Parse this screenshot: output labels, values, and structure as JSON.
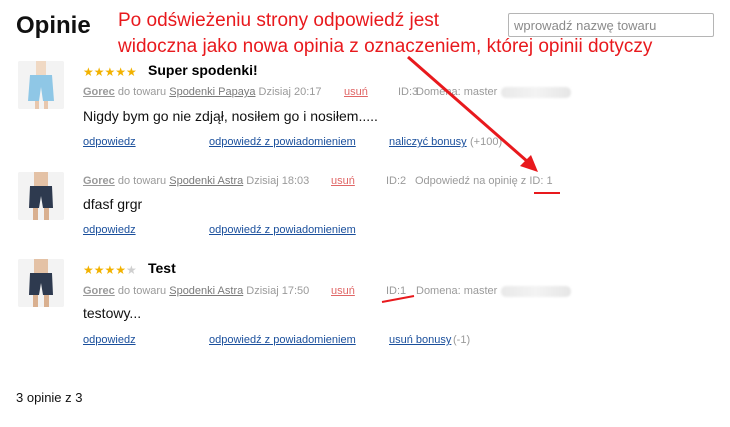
{
  "page": {
    "title": "Opinie"
  },
  "search": {
    "placeholder": "wprowadź nazwę towaru"
  },
  "annotation": {
    "line1": "Po odświeżeniu strony odpowiedź jest",
    "line2": "widoczna jako nowa opinia z oznaczeniem, której opinii dotyczy",
    "color": "#e8191d"
  },
  "reviews": [
    {
      "stars": "★★★★★",
      "stars_empty": "",
      "title": "Super spodenki!",
      "author": "Gorec",
      "product_prefix": "do towaru",
      "product": "Spodenki Papaya",
      "date": "Dzisiaj 20:17",
      "delete": "usuń",
      "id": "ID:3",
      "extra": "Domena: master",
      "text": "Nigdy bym go nie zdjął, nosiłem go i nosiłem.....",
      "actions": {
        "reply": "odpowiedz",
        "reply_notify": "odpowiedź z powiadomieniem",
        "bonus": "naliczyć bonusy",
        "bonus_note": "(+100)"
      }
    },
    {
      "title": "",
      "author": "Gorec",
      "product_prefix": "do towaru",
      "product": "Spodenki Astra",
      "date": "Dzisiaj 18:03",
      "delete": "usuń",
      "id": "ID:2",
      "extra": "Odpowiedź na opinię z ID: 1",
      "text": "dfasf grgr",
      "actions": {
        "reply": "odpowiedz",
        "reply_notify": "odpowiedź z powiadomieniem"
      }
    },
    {
      "stars": "★★★★",
      "stars_empty": "★",
      "title": "Test",
      "author": "Gorec",
      "product_prefix": "do towaru",
      "product": "Spodenki Astra",
      "date": "Dzisiaj 17:50",
      "delete": "usuń",
      "id": "ID:1",
      "extra": "Domena: master",
      "text": "testowy...",
      "actions": {
        "reply": "odpowiedz",
        "reply_notify": "odpowiedź z powiadomieniem",
        "bonus": "usuń bonusy",
        "bonus_note": "(-1)"
      }
    }
  ],
  "footer": {
    "count": "3 opinie z 3"
  },
  "icons": {
    "star": "star-icon",
    "arrow": "red-arrow-annotation"
  }
}
